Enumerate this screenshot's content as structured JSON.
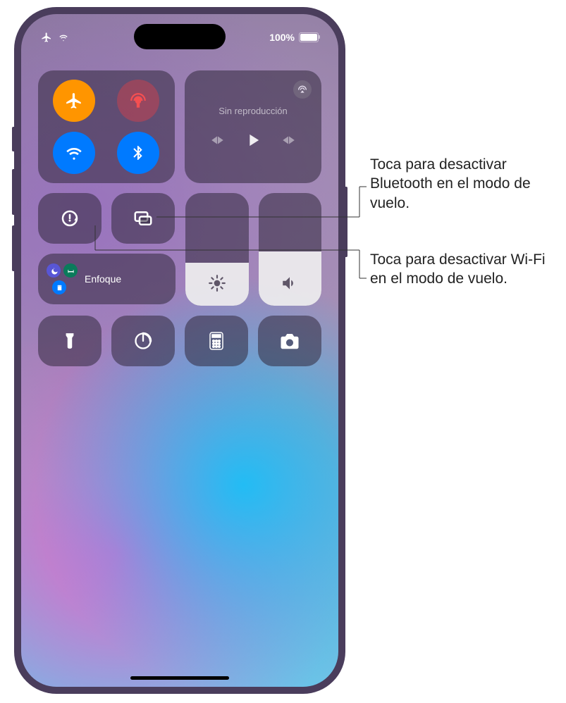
{
  "status": {
    "battery_percent": "100%",
    "airplane_icon": "airplane-icon",
    "wifi_icon": "wifi-icon"
  },
  "connectivity": {
    "airplane": {
      "name": "airplane-mode-toggle",
      "active": true
    },
    "cellular": {
      "name": "cellular-data-toggle",
      "active": false
    },
    "wifi": {
      "name": "wifi-toggle",
      "active": true
    },
    "bluetooth": {
      "name": "bluetooth-toggle",
      "active": true
    }
  },
  "media": {
    "now_playing_label": "Sin reproducción",
    "airplay_name": "airplay-button"
  },
  "orientation_lock": {
    "name": "orientation-lock-toggle"
  },
  "screen_mirror": {
    "name": "screen-mirroring-button"
  },
  "focus": {
    "label": "Enfoque"
  },
  "brightness": {
    "fill_percent": 38
  },
  "volume": {
    "fill_percent": 48
  },
  "actions": {
    "flashlight": "flashlight-button",
    "timer": "timer-button",
    "calculator": "calculator-button",
    "camera": "camera-button"
  },
  "annotations": {
    "bluetooth_note": "Toca para desactivar Bluetooth en el modo de vuelo.",
    "wifi_note": "Toca para desactivar Wi-Fi en el modo de vuelo."
  },
  "colors": {
    "orange": "#ff9500",
    "blue": "#007aff"
  }
}
